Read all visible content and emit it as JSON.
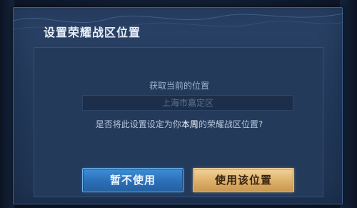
{
  "dialog": {
    "title": "设置荣耀战区位置",
    "location_label": "获取当前的位置",
    "location_value": "上海市嘉定区",
    "question_prefix": "是否将此设置设定为你",
    "question_highlight": "本周",
    "question_suffix": "的荣耀战区位置?",
    "cancel_label": "暂不使用",
    "confirm_label": "使用该位置"
  },
  "colors": {
    "dialog_bg": "#233a5c",
    "cancel_button": "#2b6fb8",
    "confirm_button": "#ddb06a",
    "highlight_text": "#ffffff"
  }
}
